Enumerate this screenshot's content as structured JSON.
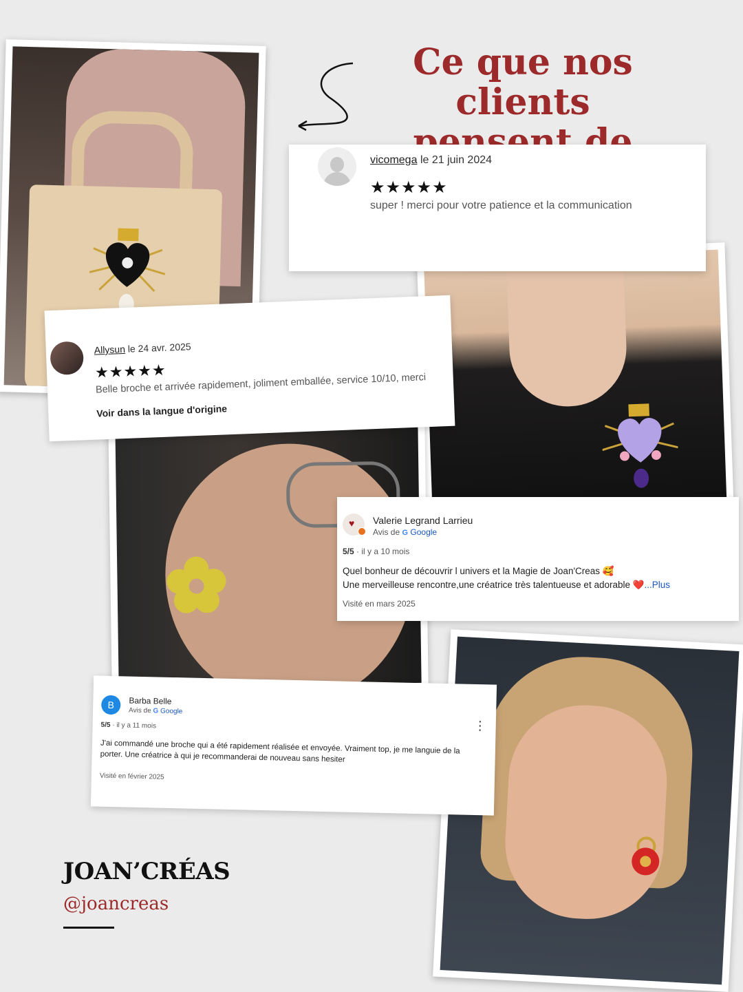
{
  "heading": {
    "line1": "Ce que nos clients",
    "line2": "pensent de nous"
  },
  "colors": {
    "accent": "#9c2a2a",
    "background": "#ebebeb"
  },
  "reviews": {
    "vicomega": {
      "author": "vicomega",
      "date": "le 21 juin 2024",
      "stars": "★★★★★",
      "text": "super ! merci pour votre patience et la communication"
    },
    "allysun": {
      "author": "Allysun",
      "date": "le 24 avr. 2025",
      "stars": "★★★★★",
      "text": "Belle broche et arrivée rapidement, joliment emballée, service 10/10, merci",
      "translate": "Voir dans la langue d'origine"
    },
    "valerie": {
      "author": "Valerie Legrand Larrieu",
      "source_prefix": "Avis de",
      "source": "Google",
      "rating": "5/5",
      "time": "· il y a 10 mois",
      "text_line1": "Quel bonheur de découvrir l univers et la Magie de Joan'Creas 🥰",
      "text_line2": "Une merveilleuse rencontre,une créatrice très talentueuse et adorable ❤️",
      "more": "...Plus",
      "visited": "Visité en mars 2025"
    },
    "barba": {
      "avatar_letter": "B",
      "author": "Barba Belle",
      "source_prefix": "Avis de",
      "source": "Google",
      "rating": "5/5",
      "time": "· il y a 11 mois",
      "text": "J'ai commandé une broche qui a été rapidement réalisée et envoyée. Vraiment top, je me languie de la porter. Une créatrice à qui je recommanderai de nouveau sans hesiter",
      "visited": "Visité en février 2025",
      "menu": "⋮"
    }
  },
  "brand": {
    "name": "JOAN’CRÉAS",
    "handle": "@joancreas"
  }
}
